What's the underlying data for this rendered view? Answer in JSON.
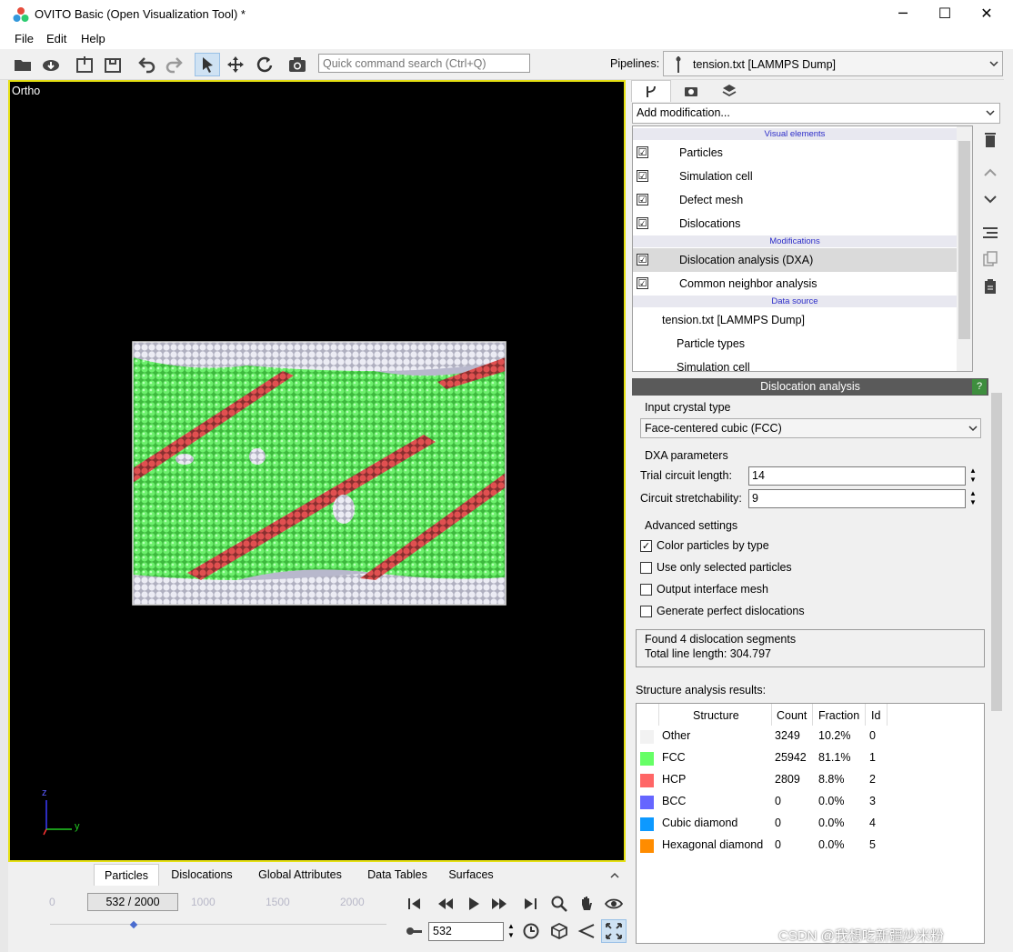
{
  "window": {
    "title": "OVITO Basic (Open Visualization Tool) *",
    "minimize": "─",
    "maximize": "☐",
    "close": "✕"
  },
  "menu": {
    "file": "File",
    "edit": "Edit",
    "help": "Help"
  },
  "toolbar": {
    "quick_search_placeholder": "Quick command search (Ctrl+Q)",
    "pipelines_label": "Pipelines:",
    "pipeline_value": "tension.txt [LAMMPS Dump]"
  },
  "viewport": {
    "label": "Ortho",
    "axis_z": "z",
    "axis_y": "y"
  },
  "panel": {
    "add_modification": "Add modification...",
    "sections": {
      "visual": "Visual elements",
      "modifications": "Modifications",
      "source": "Data source"
    },
    "visual_items": [
      {
        "label": "Particles",
        "checked": "☑"
      },
      {
        "label": "Simulation cell",
        "checked": "☑"
      },
      {
        "label": "Defect mesh",
        "checked": "☑"
      },
      {
        "label": "Dislocations",
        "checked": "☑"
      }
    ],
    "modifier_items": [
      {
        "label": "Dislocation analysis (DXA)",
        "checked": "☑"
      },
      {
        "label": "Common neighbor analysis",
        "checked": "☑"
      }
    ],
    "source_items": [
      "tension.txt [LAMMPS Dump]",
      "Particle types",
      "Simulation cell"
    ]
  },
  "dxa": {
    "header": "Dislocation analysis",
    "help": "?",
    "input_crystal_label": "Input crystal type",
    "crystal_value": "Face-centered cubic (FCC)",
    "params_label": "DXA parameters",
    "trial_label": "Trial circuit length:",
    "trial_value": "14",
    "stretch_label": "Circuit stretchability:",
    "stretch_value": "9",
    "advanced_label": "Advanced settings",
    "options": [
      {
        "label": "Color particles by type",
        "mark": "✓"
      },
      {
        "label": "Use only selected particles",
        "mark": ""
      },
      {
        "label": "Output interface mesh",
        "mark": ""
      },
      {
        "label": "Generate perfect dislocations",
        "mark": ""
      }
    ],
    "status_line1": "Found 4 dislocation segments",
    "status_line2": "Total line length: 304.797",
    "results_label": "Structure analysis results:",
    "table_headers": {
      "structure": "Structure",
      "count": "Count",
      "fraction": "Fraction",
      "id": "Id"
    },
    "rows": [
      {
        "name": "Other",
        "count": "3249",
        "fraction": "10.2%",
        "id": "0",
        "color": "#f2f2f2"
      },
      {
        "name": "FCC",
        "count": "25942",
        "fraction": "81.1%",
        "id": "1",
        "color": "#66ff66"
      },
      {
        "name": "HCP",
        "count": "2809",
        "fraction": "8.8%",
        "id": "2",
        "color": "#ff6666"
      },
      {
        "name": "BCC",
        "count": "0",
        "fraction": "0.0%",
        "id": "3",
        "color": "#6666ff"
      },
      {
        "name": "Cubic diamond",
        "count": "0",
        "fraction": "0.0%",
        "id": "4",
        "color": "#0d99ff"
      },
      {
        "name": "Hexagonal diamond",
        "count": "0",
        "fraction": "0.0%",
        "id": "5",
        "color": "#ff8c00"
      }
    ]
  },
  "bottom_tabs": [
    "Particles",
    "Dislocations",
    "Global Attributes",
    "Data Tables",
    "Surfaces"
  ],
  "timeline": {
    "frame_display": "532 / 2000",
    "ticks": [
      "0",
      "1000",
      "1500",
      "2000"
    ],
    "frame_value": "532"
  },
  "watermark": "CSDN @我想吃新疆炒米粉"
}
